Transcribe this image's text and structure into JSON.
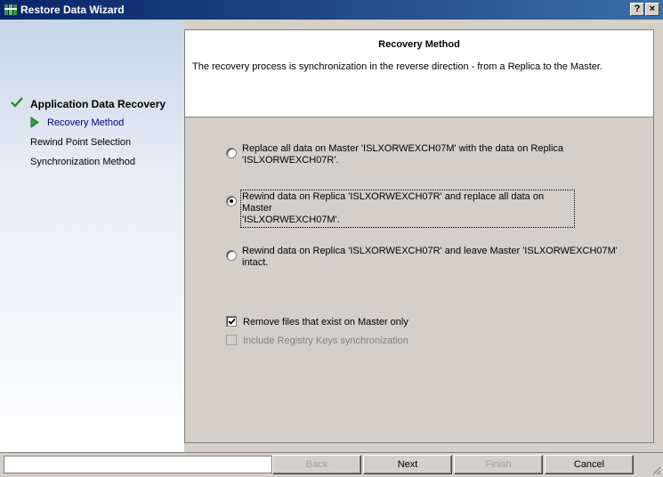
{
  "window": {
    "title": "Restore Data Wizard",
    "help_label": "?",
    "close_label": "×"
  },
  "steps": [
    {
      "label": "Application Data Recovery",
      "state": "done"
    },
    {
      "label": "Recovery Method",
      "state": "current"
    },
    {
      "label": "Rewind Point Selection",
      "state": "pending"
    },
    {
      "label": "Synchronization Method",
      "state": "pending"
    }
  ],
  "header": {
    "title": "Recovery Method",
    "description": "The recovery process is synchronization in the reverse direction - from a Replica to the Master."
  },
  "options": [
    {
      "line1": "Replace all data on Master 'ISLXORWEXCH07M' with the data on Replica",
      "line2": "'ISLXORWEXCH07R'.",
      "selected": false
    },
    {
      "line1": "Rewind data on Replica 'ISLXORWEXCH07R' and replace all data on Master",
      "line2": "'ISLXORWEXCH07M'.",
      "selected": true
    },
    {
      "line1": "Rewind data on Replica 'ISLXORWEXCH07R' and leave Master 'ISLXORWEXCH07M'",
      "line2": "intact.",
      "selected": false
    }
  ],
  "checkboxes": [
    {
      "label": "Remove files that exist on Master only",
      "checked": true,
      "enabled": true
    },
    {
      "label": "Include Registry Keys synchronization",
      "checked": false,
      "enabled": false
    }
  ],
  "buttons": {
    "back": "Back",
    "next": "Next",
    "finish": "Finish",
    "cancel": "Cancel"
  },
  "colors": {
    "title_start": "#0a246a",
    "title_end": "#3a6ea5",
    "check_green": "#2e8b2e",
    "current_step": "#000080"
  }
}
